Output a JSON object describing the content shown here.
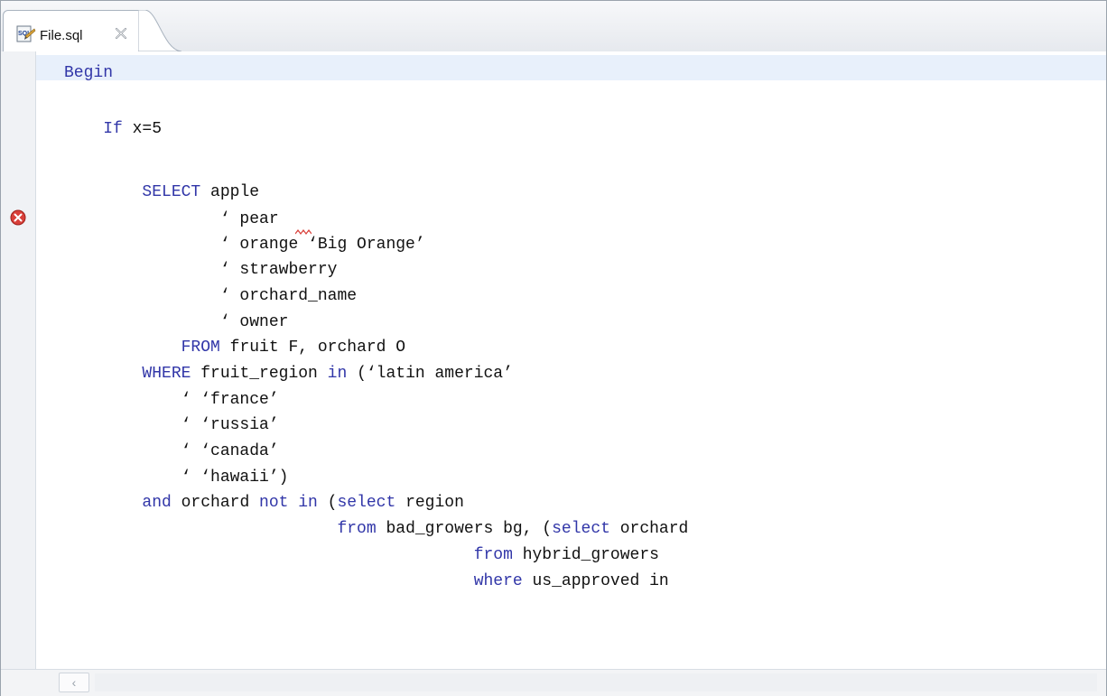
{
  "tab": {
    "icon": "sql-file-icon",
    "label": "File.sql",
    "close_icon": "close-icon"
  },
  "editor": {
    "lines": [
      {
        "indent": "",
        "segments": [
          {
            "t": "Begin",
            "k": true
          }
        ]
      },
      {
        "indent": "",
        "segments": []
      },
      {
        "indent": "    ",
        "segments": [
          {
            "t": "If",
            "k": true
          },
          {
            "t": " x=5",
            "k": false
          }
        ]
      },
      {
        "indent": "",
        "segments": []
      },
      {
        "indent": "        ",
        "segments": [
          {
            "t": "SELECT",
            "k": true
          },
          {
            "t": " apple",
            "k": false
          }
        ]
      },
      {
        "indent": "                ",
        "segments": [
          {
            "t": "‘ pear",
            "k": false
          }
        ]
      },
      {
        "indent": "                ",
        "segments": [
          {
            "t": "‘ orange ‘Big Orange’",
            "k": false
          }
        ]
      },
      {
        "indent": "                ",
        "segments": [
          {
            "t": "‘ strawberry",
            "k": false
          }
        ]
      },
      {
        "indent": "                ",
        "segments": [
          {
            "t": "‘ orchard_name",
            "k": false
          }
        ]
      },
      {
        "indent": "                ",
        "segments": [
          {
            "t": "‘ owner",
            "k": false
          }
        ]
      },
      {
        "indent": "            ",
        "segments": [
          {
            "t": "FROM",
            "k": true
          },
          {
            "t": " fruit F, orchard O",
            "k": false
          }
        ]
      },
      {
        "indent": "        ",
        "segments": [
          {
            "t": "WHERE",
            "k": true
          },
          {
            "t": " fruit_region ",
            "k": false
          },
          {
            "t": "in",
            "k": true
          },
          {
            "t": " (‘latin america’",
            "k": false
          }
        ]
      },
      {
        "indent": "            ",
        "segments": [
          {
            "t": "‘ ‘france’",
            "k": false
          }
        ]
      },
      {
        "indent": "            ",
        "segments": [
          {
            "t": "‘ ‘russia’",
            "k": false
          }
        ]
      },
      {
        "indent": "            ",
        "segments": [
          {
            "t": "‘ ‘canada’",
            "k": false
          }
        ]
      },
      {
        "indent": "            ",
        "segments": [
          {
            "t": "‘ ‘hawaii’)",
            "k": false
          }
        ]
      },
      {
        "indent": "        ",
        "segments": [
          {
            "t": "and",
            "k": true
          },
          {
            "t": " orchard ",
            "k": false
          },
          {
            "t": "not in",
            "k": true
          },
          {
            "t": " (",
            "k": false
          },
          {
            "t": "select",
            "k": true
          },
          {
            "t": " region",
            "k": false
          }
        ]
      },
      {
        "indent": "                            ",
        "segments": [
          {
            "t": "from",
            "k": true
          },
          {
            "t": " bad_growers bg, (",
            "k": false
          },
          {
            "t": "select",
            "k": true
          },
          {
            "t": " orchard",
            "k": false
          }
        ]
      },
      {
        "indent": "                                          ",
        "segments": [
          {
            "t": "from",
            "k": true
          },
          {
            "t": " hybrid_growers",
            "k": false
          }
        ]
      },
      {
        "indent": "                                          ",
        "segments": [
          {
            "t": "where",
            "k": true
          },
          {
            "t": " us_approved in",
            "k": false
          }
        ]
      }
    ],
    "error_marker_icon": "error-icon",
    "current_line": 1
  },
  "scrollbar": {
    "left_arrow": "‹",
    "left_arrow_icon": "scroll-left-icon"
  },
  "colors": {
    "keyword": "#3136a8",
    "text": "#111111",
    "current_line_highlight": "#e8f0fb",
    "error": "#d9403a"
  }
}
